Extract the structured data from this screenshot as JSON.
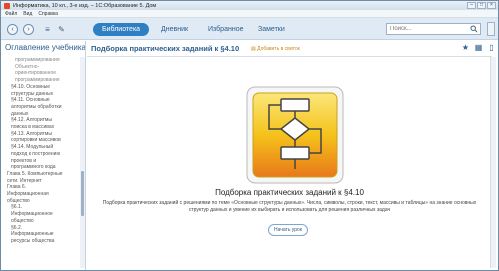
{
  "window": {
    "title": "Информатика, 10 кл., 3-е изд. – 1С:Образование 5. Дом",
    "controls": [
      "–",
      "□",
      "×"
    ]
  },
  "menu": [
    "Файл",
    "Вид",
    "Справка"
  ],
  "toolbar": {
    "back_icon": "back-arrow-icon",
    "forward_icon": "forward-arrow-icon",
    "tabs": [
      {
        "label": "Библиотека",
        "active": true
      },
      {
        "label": "Дневник",
        "active": false
      },
      {
        "label": "Избранное",
        "active": false
      },
      {
        "label": "Заметки",
        "active": false
      }
    ],
    "search_placeholder": "Поиск..."
  },
  "sidebar": {
    "title": "Оглавление учебника",
    "items": [
      {
        "text": "программирования",
        "level": 3
      },
      {
        "text": "Объектно-",
        "level": 3
      },
      {
        "text": "ориентированное",
        "level": 3
      },
      {
        "text": "программирование",
        "level": 3
      },
      {
        "text": "§4.10. Основные",
        "level": 2,
        "active": true
      },
      {
        "text": "структуры данных",
        "level": 2,
        "active": true
      },
      {
        "text": "§4.11. Основные",
        "level": 2
      },
      {
        "text": "алгоритмы обработки",
        "level": 2
      },
      {
        "text": "данных",
        "level": 2
      },
      {
        "text": "§4.12. Алгоритмы",
        "level": 2
      },
      {
        "text": "поиска в массивах",
        "level": 2
      },
      {
        "text": "§4.13. Алгоритмы",
        "level": 2
      },
      {
        "text": "сортировки массивов",
        "level": 2
      },
      {
        "text": "§4.14. Модульный",
        "level": 2
      },
      {
        "text": "подход к построению",
        "level": 2
      },
      {
        "text": "проектов и",
        "level": 2
      },
      {
        "text": "программного кода",
        "level": 2
      },
      {
        "text": "Глава 5. Компьютерные",
        "level": 1
      },
      {
        "text": "сети. Интернет",
        "level": 1
      },
      {
        "text": "Глава 6.",
        "level": 1
      },
      {
        "text": "Информационная",
        "level": 1
      },
      {
        "text": "общество",
        "level": 1
      },
      {
        "text": "§6.1.",
        "level": 2
      },
      {
        "text": "Информационное",
        "level": 2
      },
      {
        "text": "общество",
        "level": 2
      },
      {
        "text": "§6.2.",
        "level": 2
      },
      {
        "text": "Информационные",
        "level": 2
      },
      {
        "text": "ресурсы общества",
        "level": 2
      }
    ]
  },
  "content": {
    "title": "Подборка практических заданий к §4.10",
    "add_favorite": "Добавить в свиток",
    "lesson_title": "Подборка практических заданий к §4.10",
    "lesson_description": "Подборка практических заданий с решениями по теме «Основные структуры данных». Числа, символы, строки, текст, массивы и таблицы» на знание основных структур данных и умение их выбирать и использовать для решения различных задач",
    "start_button": "Начать урок"
  },
  "colors": {
    "accent": "#2f7fc3",
    "title_blue": "#2d5f8f",
    "icon_yellow": "#f5c21b",
    "icon_orange": "#e8791a"
  }
}
